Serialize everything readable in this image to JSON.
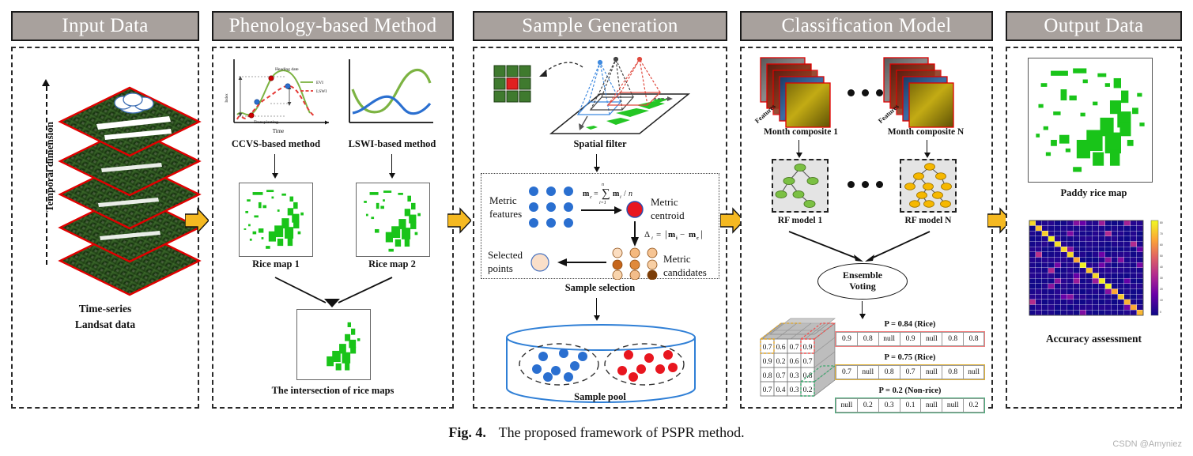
{
  "caption": {
    "prefix": "Fig. 4.",
    "text": "The proposed framework of PSPR method."
  },
  "watermark": "CSDN @Amyniez",
  "colors": {
    "header_bg": "#a8a19d",
    "header_text": "#ffffff",
    "arrow_yellow": "#f5b921",
    "rice_green": "#19c419",
    "evi_green": "#7cb342",
    "lswi_red": "#e53935",
    "blue_dot": "#2a6fd0",
    "red_dot": "#e8161f"
  },
  "panels": [
    {
      "id": "input-data",
      "title": "Input Data",
      "caption_lines": [
        "Time-series",
        "Landsat data"
      ],
      "axis_label": "Temporal dimension",
      "stack_layers": 5
    },
    {
      "id": "phenology-based-method",
      "title": "Phenology-based Method",
      "charts": [
        {
          "name": "ccvs-chart",
          "label": "CCVS-based method",
          "axis_x": "Time",
          "axis_y": "Index",
          "annotations": [
            "Heading date",
            "Transplanting"
          ],
          "legend": [
            "EVI",
            "LSWI"
          ]
        },
        {
          "name": "lswi-chart",
          "label": "LSWI-based method",
          "axis_x": "",
          "axis_y": "",
          "annotations": [],
          "legend": []
        }
      ],
      "maps": [
        {
          "label": "Rice map 1"
        },
        {
          "label": "Rice map 2"
        }
      ],
      "result_label": "The intersection of rice maps"
    },
    {
      "id": "sample-generation",
      "title": "Sample Generation",
      "spatial_filter_label": "Spatial filter",
      "sample_selection_label": "Sample selection",
      "sample_pool_label": "Sample pool",
      "selection": {
        "metric_features_label": "Metric features",
        "metric_centroid_label": "Metric centroid",
        "metric_candidates_label": "Metric candidates",
        "selected_points_label": "Selected points",
        "centroid_formula": "m_c = Σ m_i / n",
        "delta_formula": "Δ_i = |m_i − m_c|"
      }
    },
    {
      "id": "classification-model",
      "title": "Classification Model",
      "composites": [
        {
          "label": "Month composite 1",
          "features_label": "Features"
        },
        {
          "label": "Month composite N",
          "features_label": "Features"
        }
      ],
      "models": [
        {
          "label": "RF model 1"
        },
        {
          "label": "RF model N"
        }
      ],
      "ensemble_label": [
        "Ensemble",
        "Voting"
      ],
      "cube_matrix": [
        [
          "0.7",
          "0.6",
          "0.7",
          "0.9"
        ],
        [
          "0.9",
          "0.2",
          "0.6",
          "0.7"
        ],
        [
          "0.8",
          "0.7",
          "0.3",
          "0.8"
        ],
        [
          "0.7",
          "0.4",
          "0.3",
          "0.2"
        ]
      ],
      "probability_rows": [
        {
          "title": "P = 0.84   (Rice)",
          "border": "#f08080",
          "values": [
            "0.9",
            "0.8",
            "null",
            "0.9",
            "null",
            "0.8",
            "0.8"
          ]
        },
        {
          "title": "P = 0.75 (Rice)",
          "border": "#e0b33a",
          "values": [
            "0.7",
            "null",
            "0.8",
            "0.7",
            "null",
            "0.8",
            "null"
          ]
        },
        {
          "title": "P = 0.2 (Non-rice)",
          "border": "#4caf7d",
          "values": [
            "null",
            "0.2",
            "0.3",
            "0.1",
            "null",
            "null",
            "0.2"
          ]
        }
      ]
    },
    {
      "id": "output-data",
      "title": "Output Data",
      "outputs": [
        {
          "label": "Paddy rice map"
        },
        {
          "label": "Accuracy assessment"
        }
      ],
      "accuracy_matrix": {
        "size": 18,
        "colorbar_ticks": [
          "80",
          "70",
          "60",
          "50",
          "40",
          "30",
          "20",
          "10",
          "0"
        ]
      }
    }
  ]
}
